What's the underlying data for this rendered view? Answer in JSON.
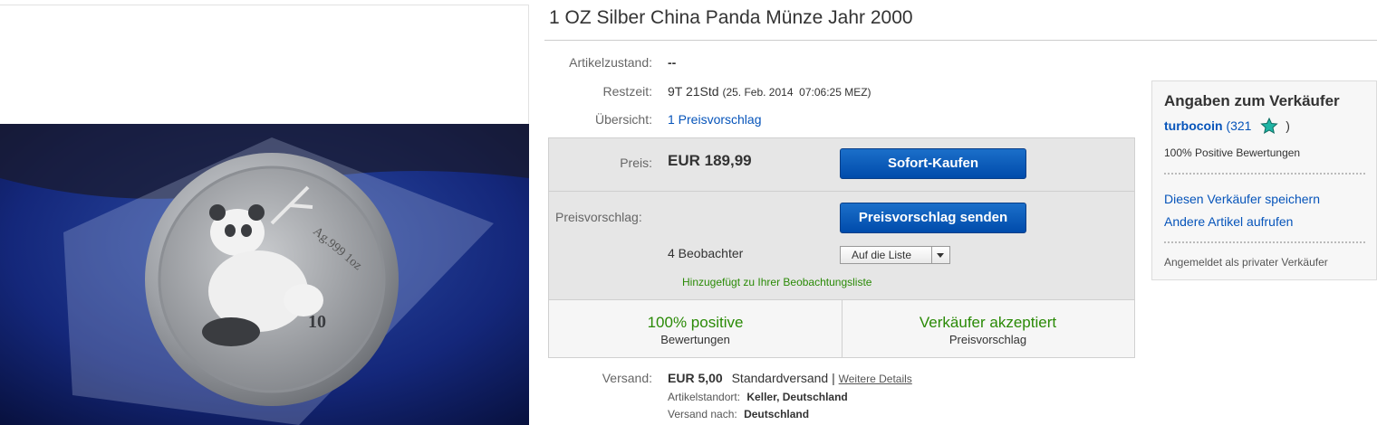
{
  "title": "1 OZ Silber China Panda Münze Jahr 2000",
  "details": {
    "condition_label": "Artikelzustand:",
    "condition_value": "--",
    "time_label": "Restzeit:",
    "time_value": "9T 21Std",
    "time_date": "(25. Feb. 2014  07:06:25 MEZ)",
    "overview_label": "Übersicht:",
    "overview_link": "1 Preisvorschlag"
  },
  "price": {
    "label": "Preis:",
    "value": "EUR 189,99",
    "buy_button": "Sofort-Kaufen"
  },
  "offer": {
    "label": "Preisvorschlag:",
    "button": "Preisvorschlag senden",
    "watchers": "4 Beobachter",
    "watch_select": "Auf die Liste",
    "watch_added": "Hinzugefügt zu Ihrer Beobachtungsliste"
  },
  "stats": {
    "left_big": "100% positive",
    "left_small": "Bewertungen",
    "right_big": "Verkäufer akzeptiert",
    "right_small": "Preisvorschlag"
  },
  "shipping": {
    "label": "Versand:",
    "price": "EUR 5,00",
    "method": "Standardversand |",
    "details_link": "Weitere Details",
    "location_label": "Artikelstandort:",
    "location_value": "Keller, Deutschland",
    "ship_to_label": "Versand nach:",
    "ship_to_value": "Deutschland"
  },
  "seller": {
    "heading": "Angaben zum Verkäufer",
    "name": "turbocoin",
    "score_open": "(321",
    "score_close": ")",
    "feedback": "100% Positive Bewertungen",
    "save_link": "Diesen Verkäufer speichern",
    "other_items_link": "Andere Artikel aufrufen",
    "account_type": "Angemeldet als privater Verkäufer"
  },
  "colors": {
    "link": "#0654ba",
    "positive_green": "#2a8a06",
    "button_blue": "#0a5cc2",
    "star_teal": "#1fb5a5"
  }
}
